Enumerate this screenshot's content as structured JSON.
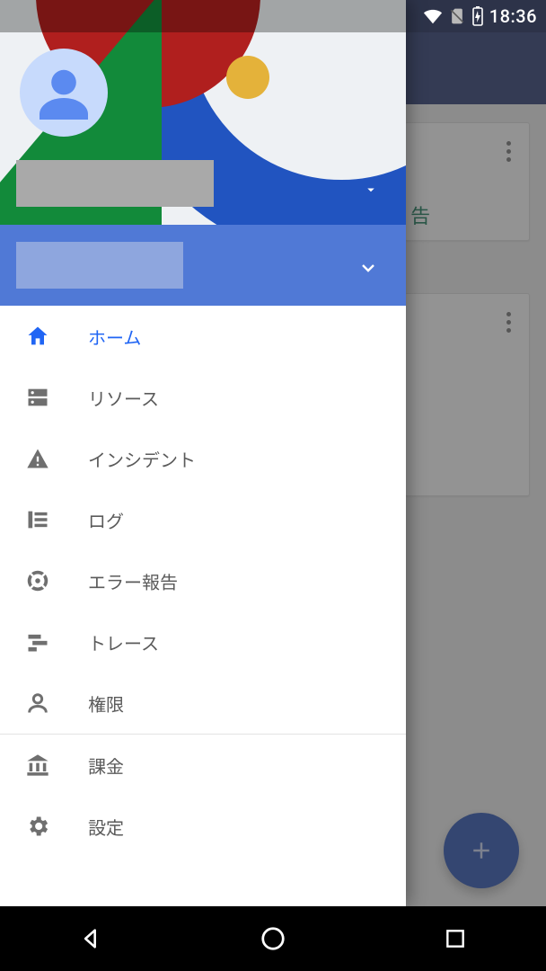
{
  "status": {
    "time": "18:36"
  },
  "underlay": {
    "card_a_link_fragment": "告"
  },
  "drawer": {
    "nav": [
      {
        "id": "home",
        "label": "ホーム",
        "icon": "home-icon",
        "active": true
      },
      {
        "id": "resources",
        "label": "リソース",
        "icon": "storage-icon",
        "active": false
      },
      {
        "id": "incidents",
        "label": "インシデント",
        "icon": "warning-icon",
        "active": false
      },
      {
        "id": "logs",
        "label": "ログ",
        "icon": "logs-icon",
        "active": false
      },
      {
        "id": "errors",
        "label": "エラー報告",
        "icon": "target-icon",
        "active": false
      },
      {
        "id": "trace",
        "label": "トレース",
        "icon": "trace-icon",
        "active": false
      },
      {
        "id": "iam",
        "label": "権限",
        "icon": "person-icon",
        "active": false
      }
    ],
    "nav_secondary": [
      {
        "id": "billing",
        "label": "課金",
        "icon": "bank-icon"
      },
      {
        "id": "settings",
        "label": "設定",
        "icon": "gear-icon"
      }
    ]
  }
}
